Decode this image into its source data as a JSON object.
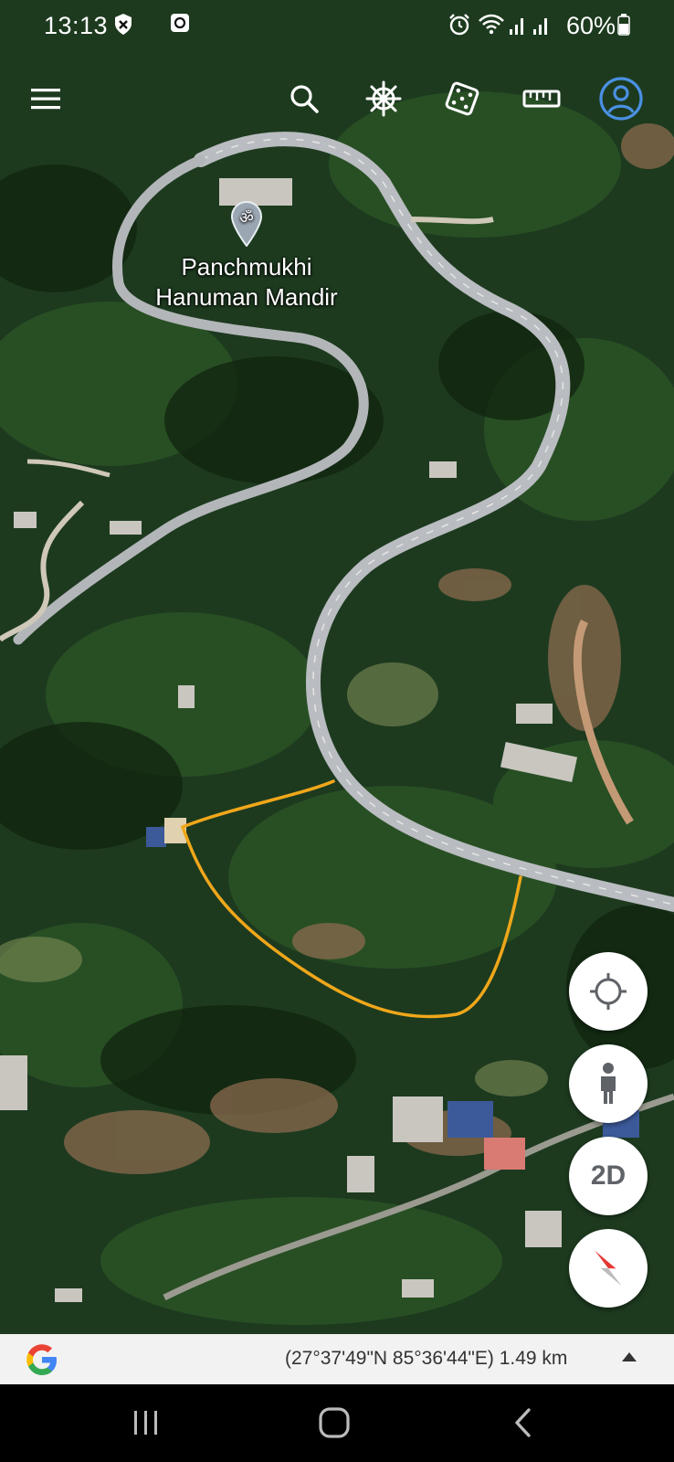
{
  "status_bar": {
    "time": "13:13",
    "battery": "60%",
    "icons": [
      "shield-x-icon",
      "notification-app-icon",
      "alarm-icon",
      "wifi-icon",
      "signal-icon",
      "signal-icon",
      "battery-icon"
    ]
  },
  "toolbar": {
    "icons": [
      "menu-icon",
      "search-icon",
      "voyager-wheel-icon",
      "dice-icon",
      "ruler-icon",
      "account-icon"
    ]
  },
  "map": {
    "place_label_line1": "Panchmukhi",
    "place_label_line2": "Hanuman Mandir",
    "place_icon": "om-pin-icon",
    "path_color": "#f0a71a",
    "road_color": "#c9ccd0"
  },
  "controls": {
    "locate_icon": "crosshair-icon",
    "pegman_icon": "pegman-icon",
    "view_mode_label": "2D",
    "compass_icon": "compass-icon"
  },
  "bottom_bar": {
    "coordinates": "(27°37'49\"N 85°36'44\"E) 1.49 km",
    "logo": "google-g-icon"
  },
  "nav_bar": {
    "icons": [
      "recents-icon",
      "home-icon",
      "back-icon"
    ]
  }
}
